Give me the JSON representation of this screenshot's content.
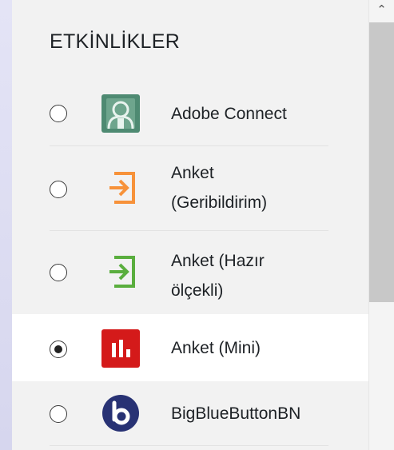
{
  "section": {
    "title": "ETKİNLİKLER"
  },
  "activities": [
    {
      "label_lines": [
        "Adobe Connect"
      ],
      "icon": "adobe-connect-icon",
      "selected": false
    },
    {
      "label_lines": [
        "Anket",
        "(Geribildirim)"
      ],
      "icon": "feedback-icon",
      "selected": false
    },
    {
      "label_lines": [
        "Anket (Hazır",
        "ölçekli)"
      ],
      "icon": "survey-icon",
      "selected": false
    },
    {
      "label_lines": [
        "Anket (Mini)"
      ],
      "icon": "poll-chart-icon",
      "selected": true
    },
    {
      "label_lines": [
        "BigBlueButtonBN"
      ],
      "icon": "bigbluebutton-icon",
      "selected": false
    }
  ],
  "scrollbar": {
    "up_arrow": "⌃",
    "up_arrow_icon": "chevron-up-icon"
  },
  "colors": {
    "adobe": "#4e8a72",
    "feedback": "#f7923a",
    "survey": "#5aae3e",
    "poll": "#d41a1a",
    "bbb": "#283274"
  }
}
